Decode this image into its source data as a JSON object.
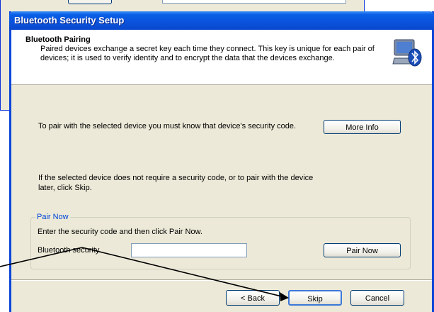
{
  "dialog": {
    "title": "Bluetooth Security Setup"
  },
  "header": {
    "title": "Bluetooth Pairing",
    "description": "Paired devices exchange a secret key each time they connect. This key is unique for each pair of devices; it is used to verify identity and to encrypt the data that the devices exchange.",
    "icon": "bluetooth-computer-icon"
  },
  "main": {
    "pair_text": "To pair with the selected device you must know that device's security code.",
    "more_info_label": "More Info",
    "skip_text": "If the selected device does not require a security code, or to pair with the device later, click Skip."
  },
  "pair_now_group": {
    "legend": "Pair Now",
    "instruction": "Enter the security code and then click Pair Now.",
    "field_label": "Bluetooth security",
    "field_value": "",
    "pair_now_label": "Pair Now"
  },
  "footer": {
    "back_label": "< Back",
    "skip_label": "Skip",
    "cancel_label": "Cancel"
  },
  "colors": {
    "titlebar": "#0a52dc",
    "dialog_bg": "#ece9d8",
    "group_legend": "#0046d5"
  }
}
